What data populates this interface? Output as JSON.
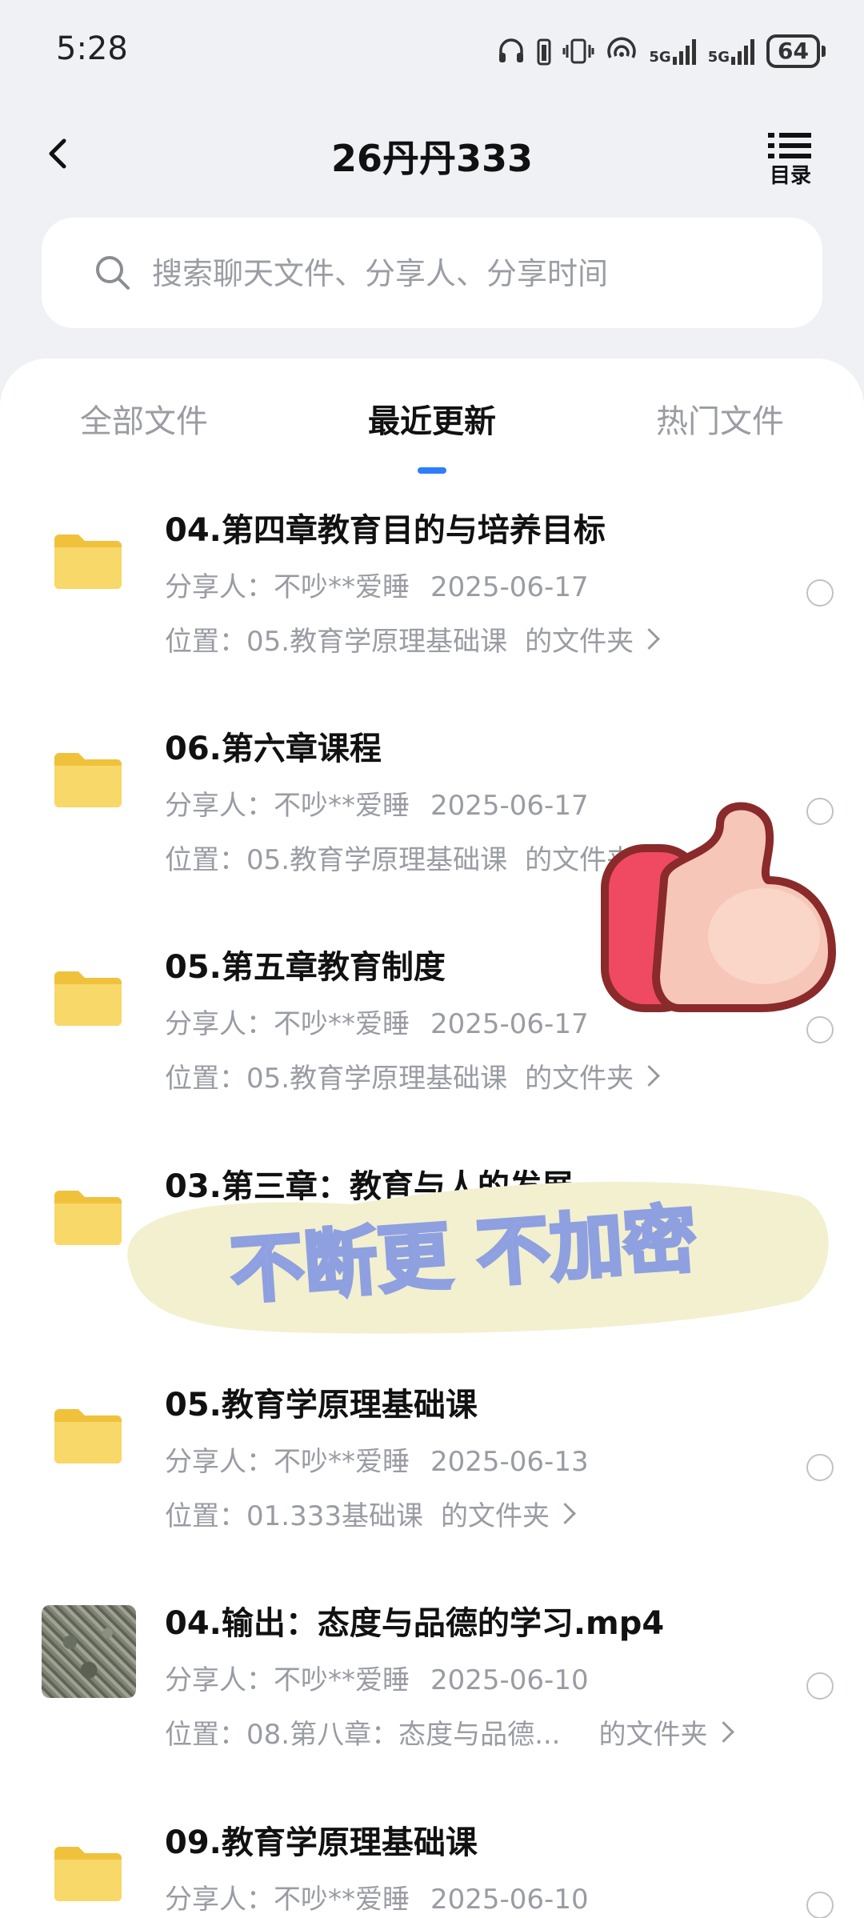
{
  "status_bar": {
    "time": "5:28",
    "signal_1_label": "5G",
    "signal_2_label": "5G",
    "battery": "64"
  },
  "header": {
    "title": "26丹丹333",
    "toc_label": "目录"
  },
  "search": {
    "placeholder": "搜索聊天文件、分享人、分享时间"
  },
  "tabs": [
    {
      "label": "全部文件"
    },
    {
      "label": "最近更新"
    },
    {
      "label": "热门文件"
    }
  ],
  "files": [
    {
      "title": "04.第四章教育目的与培养目标",
      "sharer": "分享人：不吵**爱睡",
      "date": "2025-06-17",
      "location": "位置：05.教育学原理基础课",
      "suffix": "的文件夹"
    },
    {
      "title": "06.第六章课程",
      "sharer": "分享人：不吵**爱睡",
      "date": "2025-06-17",
      "location": "位置：05.教育学原理基础课",
      "suffix": "的文件夹"
    },
    {
      "title": "05.第五章教育制度",
      "sharer": "分享人：不吵**爱睡",
      "date": "2025-06-17",
      "location": "位置：05.教育学原理基础课",
      "suffix": "的文件夹"
    },
    {
      "title": "03.第三章：教育与人的发展",
      "sharer": "",
      "date": "",
      "location": "",
      "suffix": ""
    },
    {
      "title": "05.教育学原理基础课",
      "sharer": "分享人：不吵**爱睡",
      "date": "2025-06-13",
      "location": "位置：01.333基础课",
      "suffix": "的文件夹"
    },
    {
      "title": "04.输出：态度与品德的学习.mp4",
      "sharer": "分享人：不吵**爱睡",
      "date": "2025-06-10",
      "location": "位置：08.第八章：态度与品德...",
      "suffix": "的文件夹"
    },
    {
      "title": "09.教育学原理基础课",
      "sharer": "分享人：不吵**爱睡",
      "date": "2025-06-10",
      "location": "",
      "suffix": ""
    }
  ],
  "overlay": {
    "banner_text": "不断更 不加密"
  },
  "colors": {
    "accent": "#2d7ff9",
    "folder": "#f6cf4f",
    "banner_bg": "#f2f0cf",
    "banner_text": "#9aa9e6"
  }
}
